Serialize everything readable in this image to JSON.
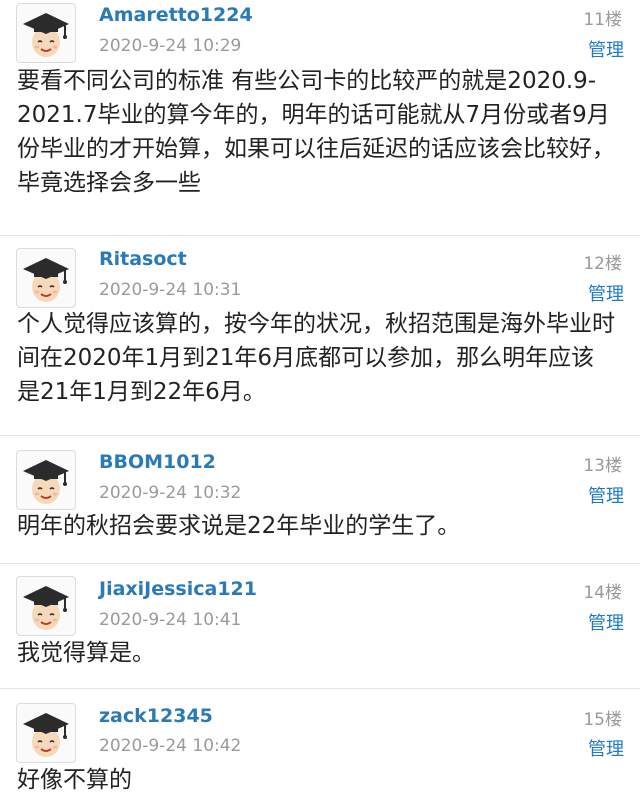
{
  "icons": {
    "avatar": "graduate-avatar-icon"
  },
  "colors": {
    "username": "#2a7ab8",
    "manage_link": "#1f7ac9",
    "meta_text": "#9a9a9a",
    "body_text": "#222222",
    "divider": "#e4e4e4"
  },
  "posts": [
    {
      "username": "Amaretto1224",
      "timestamp": "2020-9-24 10:29",
      "floor": "11楼",
      "manage_label": "管理",
      "content": "要看不同公司的标准 有些公司卡的比较严的就是2020.9-2021.7毕业的算今年的，明年的话可能就从7月份或者9月份毕业的才开始算，如果可以往后延迟的话应该会比较好，毕竟选择会多一些"
    },
    {
      "username": "Ritasoct",
      "timestamp": "2020-9-24 10:31",
      "floor": "12楼",
      "manage_label": "管理",
      "content": "个人觉得应该算的，按今年的状况，秋招范围是海外毕业时间在2020年1月到21年6月底都可以参加，那么明年应该是21年1月到22年6月。"
    },
    {
      "username": "BBOM1012",
      "timestamp": "2020-9-24 10:32",
      "floor": "13楼",
      "manage_label": "管理",
      "content": "明年的秋招会要求说是22年毕业的学生了。"
    },
    {
      "username": "JiaxiJessica121",
      "timestamp": "2020-9-24 10:41",
      "floor": "14楼",
      "manage_label": "管理",
      "content": "我觉得算是。"
    },
    {
      "username": "zack12345",
      "timestamp": "2020-9-24 10:42",
      "floor": "15楼",
      "manage_label": "管理",
      "content": "好像不算的"
    }
  ]
}
